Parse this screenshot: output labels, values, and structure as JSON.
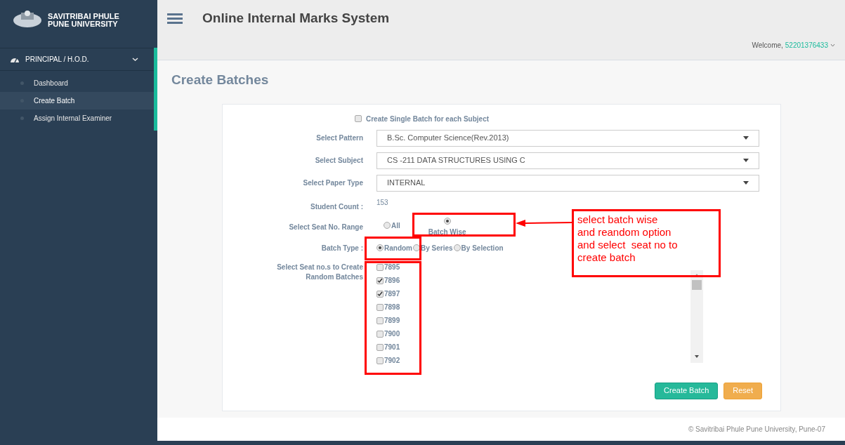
{
  "sidebar": {
    "brand_lines": [
      "SAVITRIBAI PHULE",
      "PUNE UNIVERSITY"
    ],
    "section": {
      "label": "PRINCIPAL / H.O.D.",
      "expanded": true
    },
    "items": [
      {
        "label": "Dashboard",
        "selected": false
      },
      {
        "label": "Create Batch",
        "selected": true
      },
      {
        "label": "Assign Internal Examiner",
        "selected": false
      }
    ]
  },
  "header": {
    "title": "Online Internal Marks System",
    "welcome": "Welcome,",
    "user": "52201376433"
  },
  "page_title": "Create Batches",
  "form": {
    "single_batch": {
      "label": "Create Single Batch for each Subject",
      "checked": false
    },
    "selects": [
      {
        "label": "Select Pattern",
        "value": "B.Sc. Computer Science(Rev.2013)"
      },
      {
        "label": "Select Subject",
        "value": "CS -211 DATA STRUCTURES USING C"
      },
      {
        "label": "Select Paper Type",
        "value": "INTERNAL"
      }
    ],
    "student_count": {
      "label": "Student Count :",
      "value": "153"
    },
    "seat_range": {
      "label": "Select Seat No. Range",
      "options": [
        {
          "label": "All",
          "selected": false
        },
        {
          "label": "Batch Wise",
          "selected": true
        }
      ]
    },
    "batch_type": {
      "label": "Batch Type :",
      "options": [
        {
          "label": "Random",
          "selected": true
        },
        {
          "label": "By Series",
          "selected": false
        },
        {
          "label": "By Selection",
          "selected": false
        }
      ]
    },
    "seat_list": {
      "label": "Select Seat no.s to Create Random Batches",
      "items": [
        {
          "label": "7895",
          "checked": false
        },
        {
          "label": "7896",
          "checked": true
        },
        {
          "label": "7897",
          "checked": true
        },
        {
          "label": "7898",
          "checked": false
        },
        {
          "label": "7899",
          "checked": false
        },
        {
          "label": "7900",
          "checked": false
        },
        {
          "label": "7901",
          "checked": false
        },
        {
          "label": "7902",
          "checked": false
        }
      ]
    },
    "buttons": [
      {
        "label": "Create Batch",
        "kind": "primary"
      },
      {
        "label": "Reset",
        "kind": "warning"
      }
    ]
  },
  "annotation": {
    "lines": [
      "select batch wise",
      "and reandom option",
      "and select  seat no to",
      "create batch"
    ]
  },
  "footer": "© Savitribai Phule Pune University, Pune-07"
}
